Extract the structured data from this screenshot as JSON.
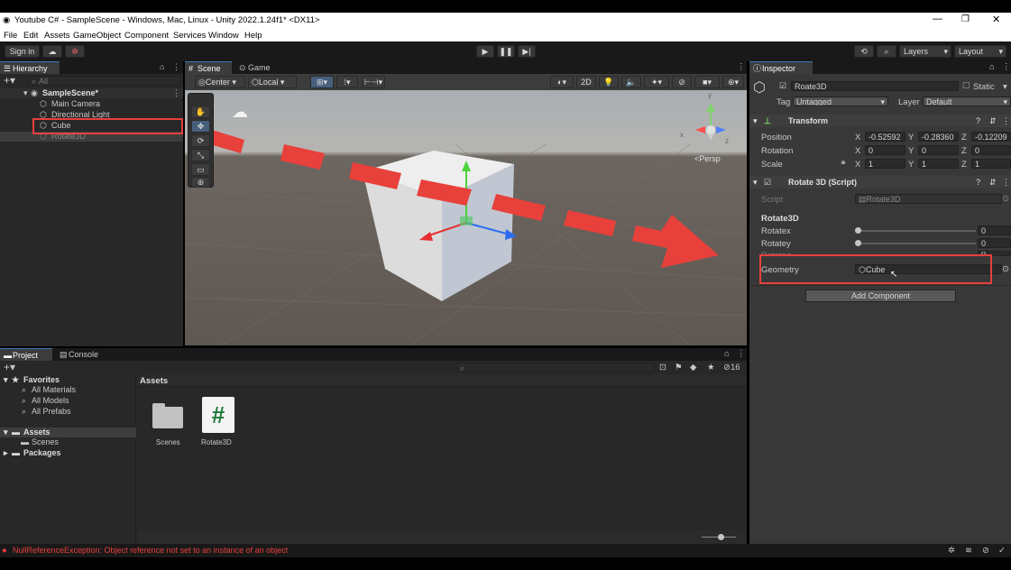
{
  "window": {
    "title": "Youtube C# - SampleScene - Windows, Mac, Linux - Unity 2022.1.24f1* <DX11>"
  },
  "menu": [
    "File",
    "Edit",
    "Assets",
    "GameObject",
    "Component",
    "Services",
    "Window",
    "Help"
  ],
  "toolbar": {
    "sign_in": "Sign in",
    "layers": "Layers",
    "layout": "Layout"
  },
  "hierarchy": {
    "tab": "Hierarchy",
    "search_placeholder": "All",
    "scene": "SampleScene*",
    "items": [
      "Main Camera",
      "Directional Light",
      "Cube",
      "Rotate3D"
    ]
  },
  "scene_view": {
    "tabs": [
      "Scene",
      "Game"
    ],
    "pivot": "Center",
    "space": "Local",
    "mode_2d": "2D",
    "persp": "<Persp",
    "gizmo_axes": {
      "x": "x",
      "y": "y",
      "z": "z"
    }
  },
  "inspector": {
    "tab": "Inspector",
    "object_name": "Roate3D",
    "static_label": "Static",
    "tag_label": "Tag",
    "tag_value": "Untagged",
    "layer_label": "Layer",
    "layer_value": "Default",
    "transform": {
      "title": "Transform",
      "position": {
        "label": "Position",
        "x": "-0.52592",
        "y": "-0.28360",
        "z": "-0.12209"
      },
      "rotation": {
        "label": "Rotation",
        "x": "0",
        "y": "0",
        "z": "0"
      },
      "scale": {
        "label": "Scale",
        "x": "1",
        "y": "1",
        "z": "1"
      }
    },
    "script_component": {
      "title": "Rotate 3D (Script)",
      "script_label": "Script",
      "script_value": "Rotate3D",
      "section": "Rotate3D",
      "sliders": [
        {
          "label": "Rotatex",
          "value": "0"
        },
        {
          "label": "Rotatey",
          "value": "0"
        },
        {
          "label": "Rotatez",
          "value": "0"
        }
      ],
      "geometry_label": "Geometry",
      "geometry_value": "Cube"
    },
    "add_component": "Add Component"
  },
  "project": {
    "tabs": [
      "Project",
      "Console"
    ],
    "favorites": "Favorites",
    "favorite_items": [
      "All Materials",
      "All Models",
      "All Prefabs"
    ],
    "assets": "Assets",
    "asset_folders": [
      "Scenes"
    ],
    "packages": "Packages",
    "breadcrumb": "Assets",
    "grid_items": [
      "Scenes",
      "Rotate3D"
    ],
    "hidden_count": "16"
  },
  "status": {
    "error": "NullReferenceException: Object reference not set to an instance of an object"
  }
}
